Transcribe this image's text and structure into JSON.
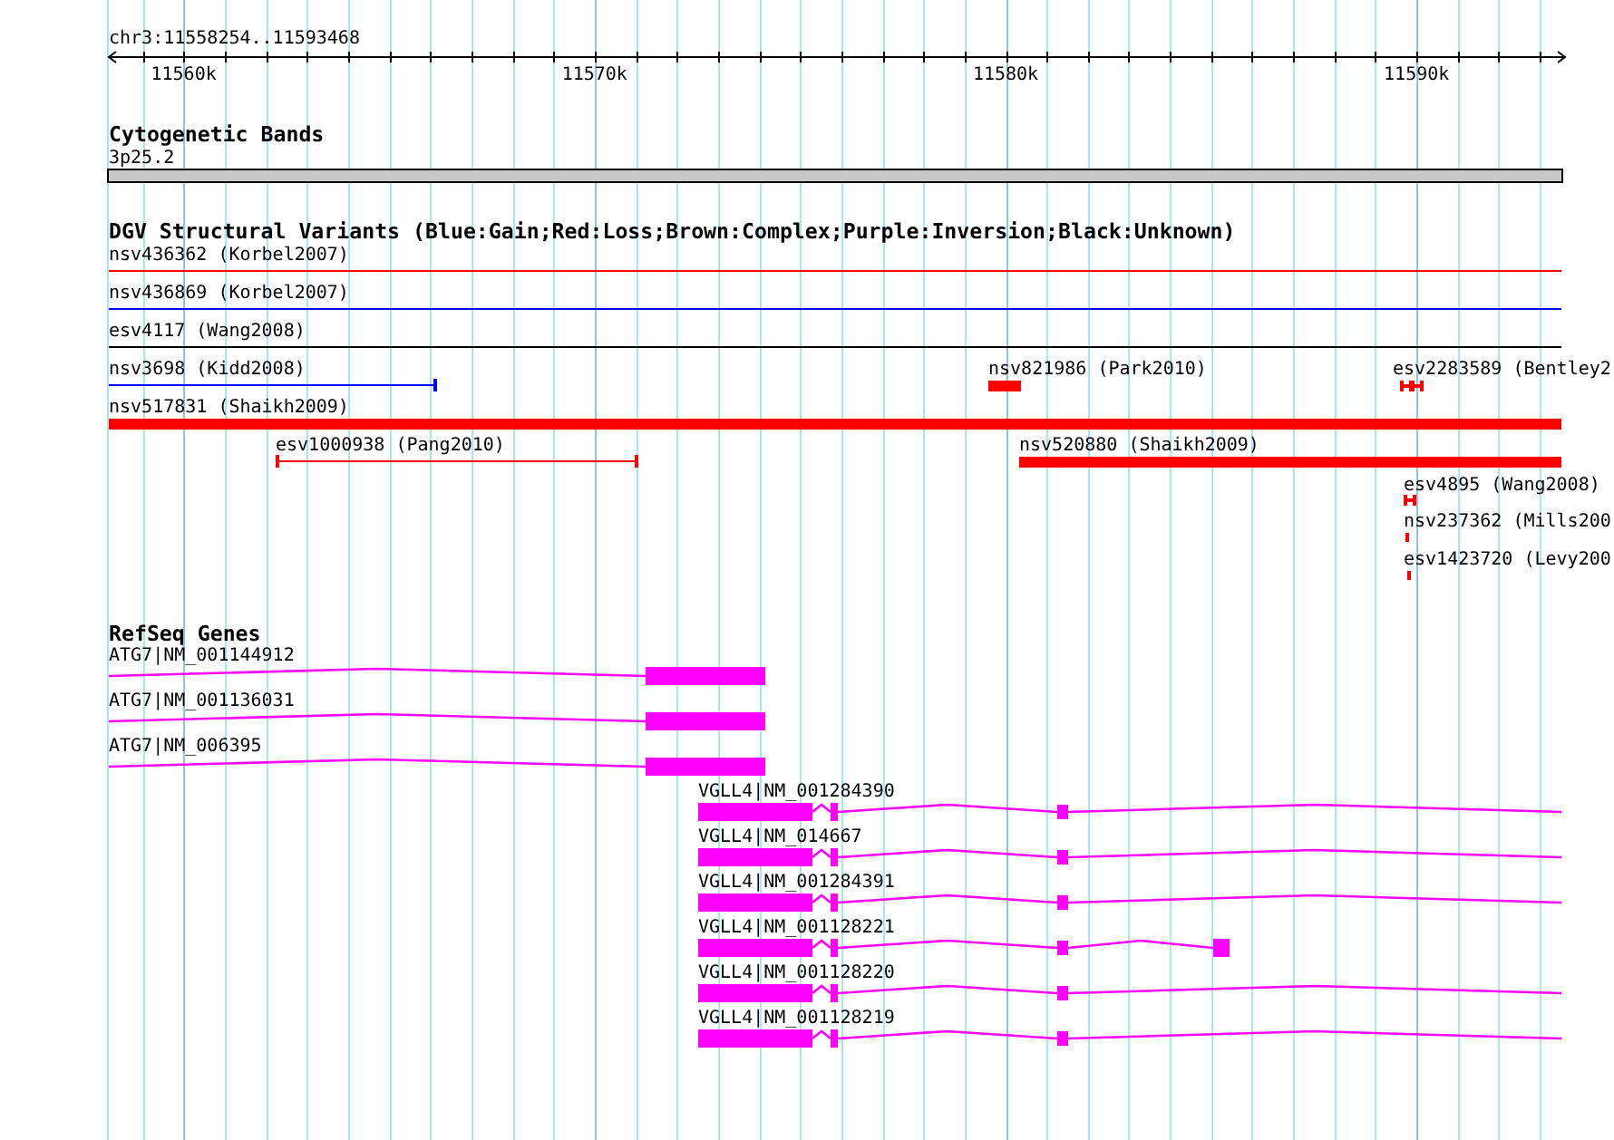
{
  "ruler": {
    "region": "chr3:11558254..11593468",
    "ticks": [
      "11560k",
      "11570k",
      "11580k",
      "11590k"
    ]
  },
  "tracks": [
    {
      "kind": "cytoband",
      "title": "Cytogenetic Bands",
      "band": "3p25.2"
    },
    {
      "kind": "variants",
      "title": "DGV Structural Variants (Blue:Gain;Red:Loss;Brown:Complex;Purple:Inversion;Black:Unknown)",
      "features": [
        {
          "label": "nsv436362 (Korbel2007)",
          "color": "#ff0000"
        },
        {
          "label": "nsv436869 (Korbel2007)",
          "color": "#0000ff"
        },
        {
          "label": "esv4117 (Wang2008)",
          "color": "#000000"
        },
        {
          "label": "nsv3698 (Kidd2008)",
          "color": "#0000ff"
        },
        {
          "label": "nsv821986 (Park2010)",
          "color": "#ff0000"
        },
        {
          "label": "esv2283589 (Bentley2",
          "color": "#ff0000"
        },
        {
          "label": "nsv517831 (Shaikh2009)",
          "color": "#ff0000"
        },
        {
          "label": "esv1000938 (Pang2010)",
          "color": "#ff0000"
        },
        {
          "label": "nsv520880 (Shaikh2009)",
          "color": "#ff0000"
        },
        {
          "label": "esv4895 (Wang2008)",
          "color": "#ff0000"
        },
        {
          "label": "nsv237362 (Mills200",
          "color": "#ff0000"
        },
        {
          "label": "esv1423720 (Levy200",
          "color": "#ff0000"
        }
      ]
    },
    {
      "kind": "genes",
      "title": "RefSeq Genes",
      "features": [
        {
          "label": "ATG7|NM_001144912"
        },
        {
          "label": "ATG7|NM_001136031"
        },
        {
          "label": "ATG7|NM_006395"
        },
        {
          "label": "VGLL4|NM_001284390"
        },
        {
          "label": "VGLL4|NM_014667"
        },
        {
          "label": "VGLL4|NM_001284391"
        },
        {
          "label": "VGLL4|NM_001128221"
        },
        {
          "label": "VGLL4|NM_001128220"
        },
        {
          "label": "VGLL4|NM_001128219"
        }
      ]
    }
  ]
}
